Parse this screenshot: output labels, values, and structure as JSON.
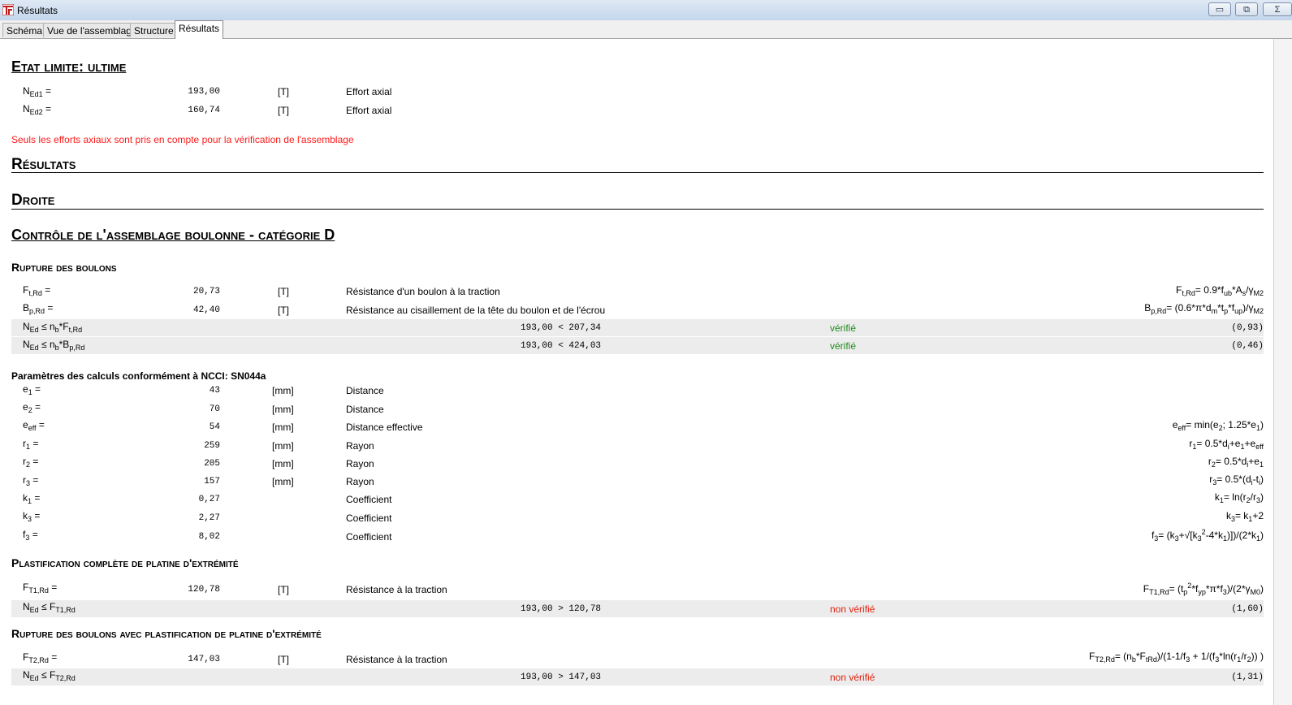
{
  "window": {
    "title": "Résultats"
  },
  "tabs": [
    "Schéma",
    "Vue de l'assemblage",
    "Structure",
    "Résultats"
  ],
  "elu": {
    "heading": "Etat limite: ultime",
    "rows": [
      {
        "sym": "N",
        "sub": "Ed1",
        "eq": " =",
        "value": "193,00",
        "unit": "[T]",
        "desc": "Effort axial"
      },
      {
        "sym": "N",
        "sub": "Ed2",
        "eq": " =",
        "value": "160,74",
        "unit": "[T]",
        "desc": "Effort axial"
      }
    ],
    "warning": "Seuls les efforts axiaux sont pris en compte pour la vérification de l'assemblage"
  },
  "resultats_heading": "Résultats",
  "droite_heading": "Droite",
  "controle_heading": "Contrôle de l'assemblage boulonne - catégorie D",
  "rupture": {
    "heading": "Rupture des boulons",
    "rows": [
      {
        "sym": "F",
        "sub": "t,Rd",
        "eq": " =",
        "value": "20,73",
        "unit": "[T]",
        "desc": "Résistance d'un boulon à la traction"
      },
      {
        "sym": "B",
        "sub": "p,Rd",
        "eq": " =",
        "value": "42,40",
        "unit": "[T]",
        "desc": "Résistance au cisaillement de la tête du boulon et de l'écrou"
      }
    ],
    "checks": [
      {
        "label_pre": "N",
        "label_sub1": "Ed",
        "label_mid": " ≤ n",
        "label_sub2": "b",
        "label_mid2": "*F",
        "label_sub3": "t,Rd",
        "comparison": "193,00 < 207,34",
        "status": "vérifié",
        "ratio": "(0,93)"
      },
      {
        "label_pre": "N",
        "label_sub1": "Ed",
        "label_mid": " ≤ n",
        "label_sub2": "b",
        "label_mid2": "*B",
        "label_sub3": "p,Rd",
        "comparison": "193,00 < 424,03",
        "status": "vérifié",
        "ratio": "(0,46)"
      }
    ]
  },
  "params": {
    "heading": "Paramètres des calculs conformément à NCCI: SN044a",
    "rows": [
      {
        "sym": "e",
        "sub": "1",
        "eq": " =",
        "value": "43",
        "unit": "[mm]",
        "desc": "Distance"
      },
      {
        "sym": "e",
        "sub": "2",
        "eq": " =",
        "value": "70",
        "unit": "[mm]",
        "desc": "Distance"
      },
      {
        "sym": "e",
        "sub": "eff",
        "eq": " =",
        "value": "54",
        "unit": "[mm]",
        "desc": "Distance effective"
      },
      {
        "sym": "r",
        "sub": "1",
        "eq": " =",
        "value": "259",
        "unit": "[mm]",
        "desc": "Rayon"
      },
      {
        "sym": "r",
        "sub": "2",
        "eq": " =",
        "value": "205",
        "unit": "[mm]",
        "desc": "Rayon"
      },
      {
        "sym": "r",
        "sub": "3",
        "eq": " =",
        "value": "157",
        "unit": "[mm]",
        "desc": "Rayon"
      },
      {
        "sym": "k",
        "sub": "1",
        "eq": " =",
        "value": "0,27",
        "unit": "",
        "desc": "Coefficient"
      },
      {
        "sym": "k",
        "sub": "3",
        "eq": " =",
        "value": "2,27",
        "unit": "",
        "desc": "Coefficient"
      },
      {
        "sym": "f",
        "sub": "3",
        "eq": " =",
        "value": "8,02",
        "unit": "",
        "desc": "Coefficient"
      }
    ]
  },
  "plastification": {
    "heading": "Plastification complète de platine d'extrémité",
    "row": {
      "sym": "F",
      "sub": "T1,Rd",
      "eq": " =",
      "value": "120,78",
      "unit": "[T]",
      "desc": "Résistance à la traction"
    },
    "check": {
      "label_pre": "N",
      "label_sub1": "Ed",
      "label_mid": " ≤ F",
      "label_sub2": "T1,Rd",
      "comparison": "193,00 > 120,78",
      "status": "non vérifié",
      "ratio": "(1,60)"
    }
  },
  "rupture_plast": {
    "heading": "Rupture des boulons avec plastification de platine d'extrémité",
    "row": {
      "sym": "F",
      "sub": "T2,Rd",
      "eq": " =",
      "value": "147,03",
      "unit": "[T]",
      "desc": "Résistance à la traction"
    },
    "check": {
      "label_pre": "N",
      "label_sub1": "Ed",
      "label_mid": " ≤ F",
      "label_sub2": "T2,Rd",
      "comparison": "193,00 > 147,03",
      "status": "non vérifié",
      "ratio": "(1,31)"
    }
  },
  "colors": {
    "warning": "#ff1a1a",
    "ok": "#1d8a1d",
    "bad": "#e0200e",
    "band": "#ececec"
  }
}
